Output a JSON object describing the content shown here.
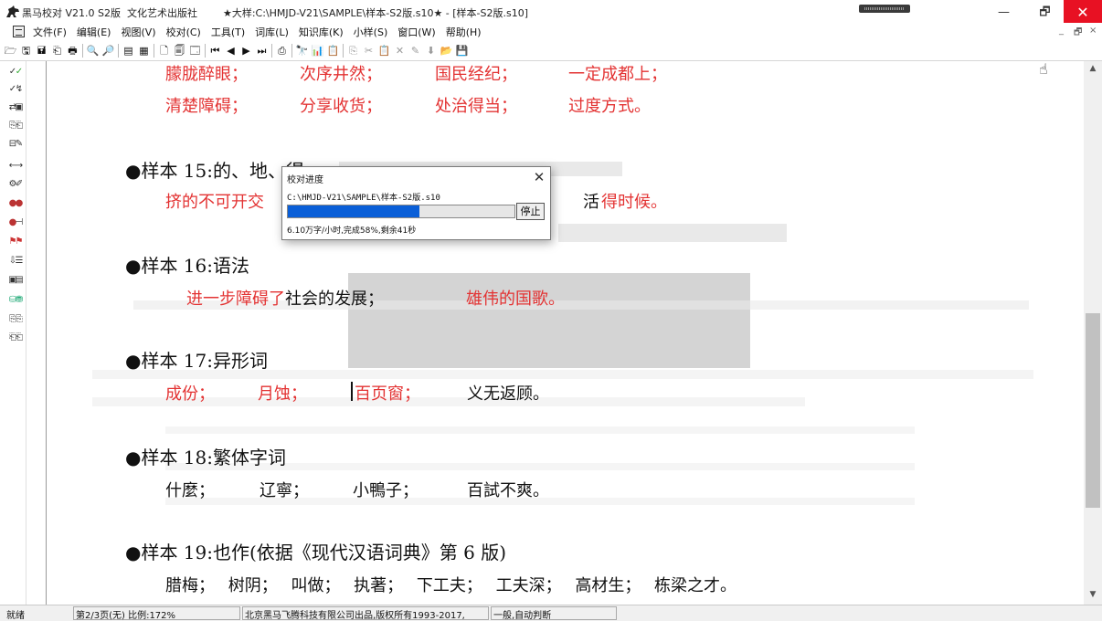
{
  "window": {
    "title": "黑马校对 V21.0 S2版  文化艺术出版社        ★大样:C:\\HMJD-V21\\SAMPLE\\样本-S2版.s10★ - [样本-S2版.s10]",
    "minimize": "—",
    "maximize": "🗗",
    "close": "✕"
  },
  "menu": {
    "items": [
      "文件(F)",
      "编辑(E)",
      "视图(V)",
      "校对(C)",
      "工具(T)",
      "词库(L)",
      "知识库(K)",
      "小样(S)",
      "窗口(W)",
      "帮助(H)"
    ],
    "mdi_min": "_",
    "mdi_restore": "🗗",
    "mdi_close": "×"
  },
  "toolbar": {
    "icons": [
      "open-folder-icon",
      "save-icon",
      "save-all-icon",
      "proof-icon",
      "print-icon",
      "zoom-in-icon",
      "zoom-out-icon",
      "page-view-icon",
      "grid-view-icon",
      "single-page-icon",
      "double-page-icon",
      "multi-page-icon",
      "first-page-icon",
      "prev-page-icon",
      "next-page-icon",
      "last-page-icon",
      "print-preview-icon",
      "find-icon",
      "chart-icon",
      "report-icon",
      "copy-icon",
      "cut-icon",
      "paste-icon",
      "delete-icon",
      "replace-icon",
      "down-arrow-icon",
      "open-file-icon",
      "save-file-icon"
    ],
    "glyphs": [
      "🗁",
      "🖫",
      "🖬",
      "⎗",
      "🖶",
      "🔍",
      "🔎",
      "▤",
      "▦",
      "🗋",
      "🗐",
      "🗔",
      "⏮",
      "◀",
      "▶",
      "⏭",
      "⎙",
      "🔭",
      "📊",
      "📋",
      "⎘",
      "✂",
      "📋",
      "✕",
      "✎",
      "⬇",
      "📂",
      "💾"
    ]
  },
  "document": {
    "top_line1": [
      "朦胧醉眼；",
      "次序井然；",
      "国民经纪；",
      "一定成都上；"
    ],
    "top_line2": [
      "清楚障碍；",
      "分享收货；",
      "处治得当；",
      "过度方式。"
    ],
    "sample15": {
      "title": "●样本 15:的、地、得",
      "line_left": "挤的不可开交",
      "line_mid": "活",
      "line_right": "得时候。"
    },
    "sample16": {
      "title": "●样本 16:语法",
      "part1": "进一步障碍了",
      "part2": "社会的发展；",
      "part3": "雄伟的国歌。"
    },
    "sample17": {
      "title": "●样本 17:异形词",
      "items": [
        "成份；",
        "月蚀；",
        "百页窗；",
        "义无返顾。"
      ]
    },
    "sample18": {
      "title": "●样本 18:繁体字词",
      "items": [
        "什麼；",
        "辽寧；",
        "小鴨子；",
        "百試不爽。"
      ]
    },
    "sample19": {
      "title": "●样本 19:也作(依据《现代汉语词典》第 6 版)",
      "text": "腊梅； 树阴； 叫做； 执著； 下工夫； 工夫深； 高材生； 栋梁之才。"
    }
  },
  "dialog": {
    "title": "校对进度",
    "close": "✕",
    "path": "C:\\HMJD-V21\\SAMPLE\\样本-S2版.s10",
    "progress": 0.58,
    "stop_label": "停止",
    "status": "6.10万字/小时,完成58%,剩余41秒"
  },
  "scroll": {
    "up": "▲",
    "down": "▼"
  },
  "statusbar": {
    "ready": "就绪",
    "page_info": "第2/3页(无) 比例:172%",
    "copyright": "北京黑马飞腾科技有限公司出品,版权所有1993-2017,",
    "mode": "一般,自动判断"
  }
}
